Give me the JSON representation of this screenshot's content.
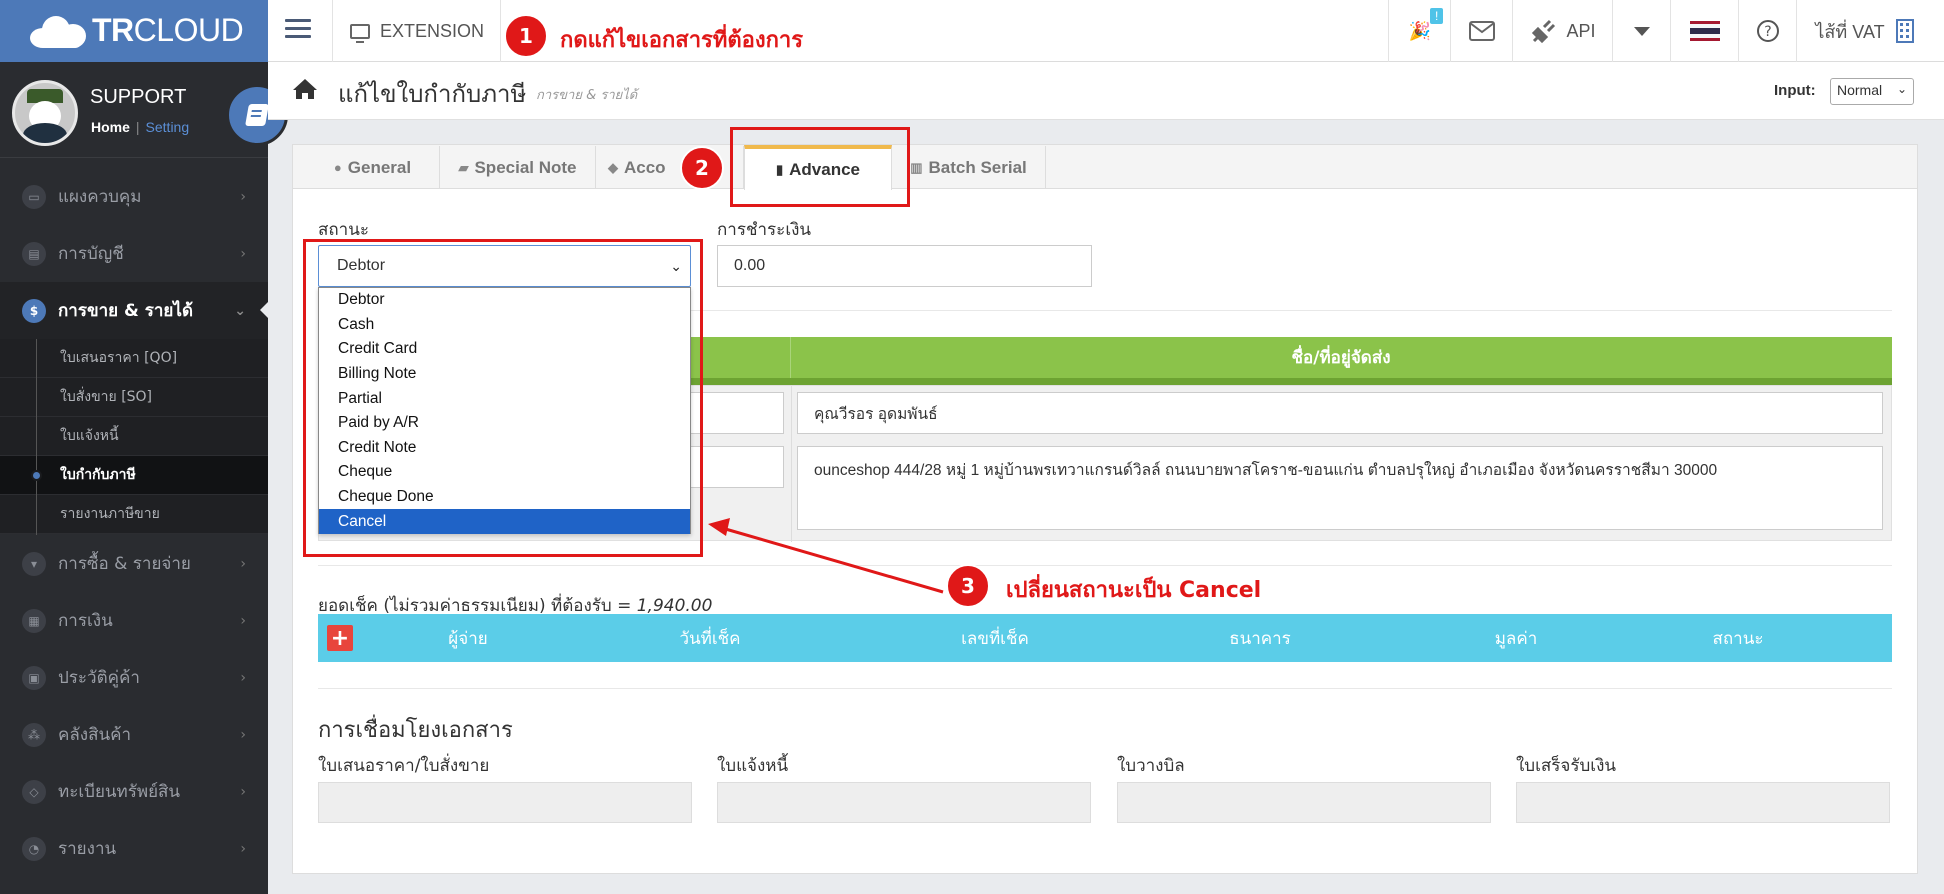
{
  "topbar": {
    "brand_strong": "TR",
    "brand_light": "CLOUD",
    "extension_label": "EXTENSION",
    "notif_count": "!",
    "api_label": "API",
    "vat_label": "ไส้ที่ VAT"
  },
  "profile": {
    "name": "SUPPORT",
    "home_link": "Home",
    "separator": "|",
    "setting_link": "Setting"
  },
  "sidebar": {
    "items": [
      {
        "label": "แผงควบคุม",
        "icon": "monitor-icon"
      },
      {
        "label": "การบัญชี",
        "icon": "book-icon"
      },
      {
        "label": "การขาย & รายได้",
        "icon": "dollar-icon"
      },
      {
        "label": "การซื้อ & รายจ่าย",
        "icon": "cart-icon"
      },
      {
        "label": "การเงิน",
        "icon": "calendar-icon"
      },
      {
        "label": "ประวัติคู่ค้า",
        "icon": "contact-icon"
      },
      {
        "label": "คลังสินค้า",
        "icon": "boxes-icon"
      },
      {
        "label": "ทะเบียนทรัพย์สิน",
        "icon": "diamond-icon"
      },
      {
        "label": "รายงาน",
        "icon": "report-icon"
      }
    ],
    "sub_items": [
      {
        "label": "ใบเสนอราคา [QO]"
      },
      {
        "label": "ใบสั่งขาย [SO]"
      },
      {
        "label": "ใบแจ้งหนี้"
      },
      {
        "label": "ใบกำกับภาษี"
      },
      {
        "label": "รายงานภาษีขาย"
      }
    ]
  },
  "header": {
    "title": "แก้ไขใบกำกับภาษี",
    "subtitle": "การขาย & รายได้",
    "input_label": "Input:",
    "input_value": "Normal"
  },
  "tabs": [
    {
      "label": "General"
    },
    {
      "label": "Special Note"
    },
    {
      "label": "Acco"
    },
    {
      "label": "Advance"
    },
    {
      "label": "Batch Serial"
    }
  ],
  "form": {
    "status_label": "สถานะ",
    "status_value": "Debtor",
    "status_options": [
      "Debtor",
      "Cash",
      "Credit Card",
      "Billing Note",
      "Partial",
      "Paid by A/R",
      "Credit Note",
      "Cheque",
      "Cheque Done",
      "Cancel"
    ],
    "status_highlighted": "Cancel",
    "payment_label": "การชำระเงิน",
    "payment_value": "0.00"
  },
  "shipping": {
    "header": "ชื่อ/ที่อยู่จัดส่ง",
    "name": "คุณวีรอร อุดมพันธ์",
    "address": "ounceshop 444/28 หมู่ 1 หมู่บ้านพรเทวาแกรนด์วิลล์ ถนนบายพาสโคราช-ขอนแก่น ตำบลปรุใหญ่ อำเภอเมือง จังหวัดนครราชสีมา 30000"
  },
  "cheque": {
    "label_prefix": "ยอดเช็ค (ไม่รวมค่าธรรมเนียม) ที่ต้องรับ = ",
    "amount": "1,940.00",
    "add_label": "+",
    "columns": [
      "ผู้จ่าย",
      "วันที่เช็ค",
      "เลขที่เช็ค",
      "ธนาคาร",
      "มูลค่า",
      "สถานะ"
    ]
  },
  "doclink": {
    "title": "การเชื่อมโยงเอกสาร",
    "fields": [
      "ใบเสนอราคา/ใบสั่งขาย",
      "ใบแจ้งหนี้",
      "ใบวางบิล",
      "ใบเสร็จรับเงิน"
    ]
  },
  "annotations": {
    "step1_num": "1",
    "step1_text": "กดแก้ไขเอกสารที่ต้องการ",
    "step2_num": "2",
    "step3_num": "3",
    "step3_text": "เปลี่ยนสถานะเป็น Cancel"
  },
  "colors": {
    "brand": "#4d79b8",
    "annotation": "#e01818",
    "green_header": "#8bc34a",
    "cheque_header": "#5bcde8",
    "selected_option": "#1f63c7"
  }
}
